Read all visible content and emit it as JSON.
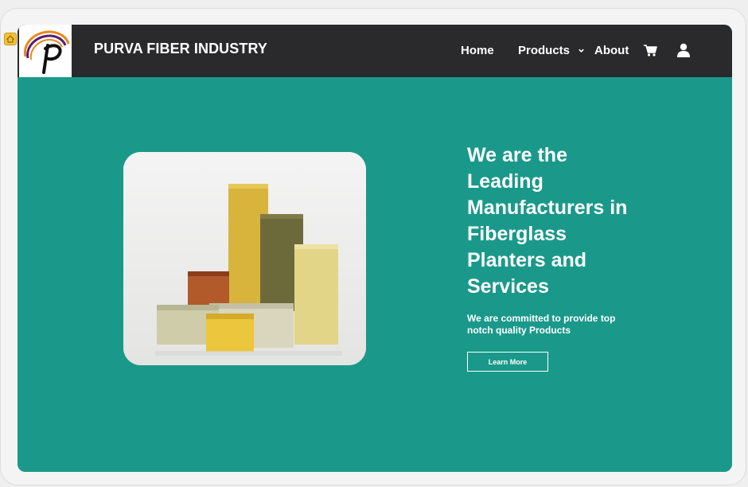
{
  "brand": {
    "name": "PURVA FIBER INDUSTRY",
    "logo_letter": "P"
  },
  "nav": {
    "home": "Home",
    "products": "Products",
    "about": "About",
    "icons": [
      "cart-icon",
      "user-icon",
      "chevron-down-icon"
    ]
  },
  "hero": {
    "title": "We are the Leading Manufacturers in Fiberglass Planters and Services",
    "subtitle": "We are committed to provide top notch quality Products",
    "button": "Learn More"
  },
  "colors": {
    "navbar": "#2a2a2c",
    "hero_background": "#1a998a",
    "text": "#ffffff",
    "logo_orange": "#e8891c",
    "logo_purple": "#5b1b6e"
  }
}
